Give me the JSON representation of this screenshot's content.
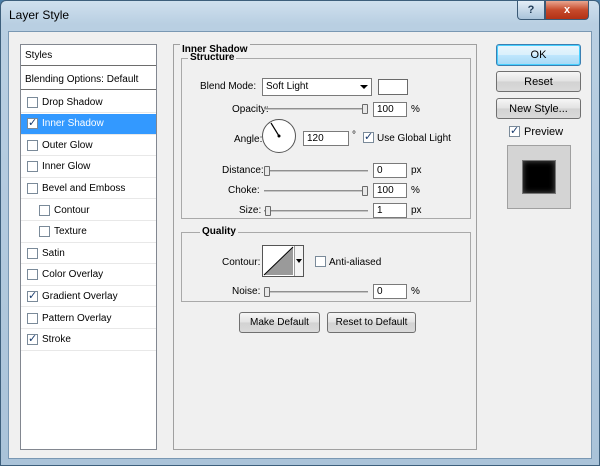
{
  "window": {
    "title": "Layer Style",
    "close_glyph": "x",
    "help_glyph": "?"
  },
  "styles_list": {
    "header": "Styles",
    "blending": "Blending Options: Default",
    "items": [
      {
        "label": "Drop Shadow",
        "checked": false,
        "indent": false,
        "selected": false
      },
      {
        "label": "Inner Shadow",
        "checked": true,
        "indent": false,
        "selected": true
      },
      {
        "label": "Outer Glow",
        "checked": false,
        "indent": false,
        "selected": false
      },
      {
        "label": "Inner Glow",
        "checked": false,
        "indent": false,
        "selected": false
      },
      {
        "label": "Bevel and Emboss",
        "checked": false,
        "indent": false,
        "selected": false
      },
      {
        "label": "Contour",
        "checked": false,
        "indent": true,
        "selected": false
      },
      {
        "label": "Texture",
        "checked": false,
        "indent": true,
        "selected": false
      },
      {
        "label": "Satin",
        "checked": false,
        "indent": false,
        "selected": false
      },
      {
        "label": "Color Overlay",
        "checked": false,
        "indent": false,
        "selected": false
      },
      {
        "label": "Gradient Overlay",
        "checked": true,
        "indent": false,
        "selected": false
      },
      {
        "label": "Pattern Overlay",
        "checked": false,
        "indent": false,
        "selected": false
      },
      {
        "label": "Stroke",
        "checked": true,
        "indent": false,
        "selected": false
      }
    ]
  },
  "panel": {
    "title": "Inner Shadow",
    "structure": {
      "title": "Structure",
      "blend_mode_label": "Blend Mode:",
      "blend_mode_value": "Soft Light",
      "swatch_color": "#ffffff",
      "opacity_label": "Opacity:",
      "opacity_value": "100",
      "angle_label": "Angle:",
      "angle_value": "120",
      "degree_sign": "°",
      "use_global_light_label": "Use Global Light",
      "use_global_light_checked": true,
      "distance_label": "Distance:",
      "distance_value": "0",
      "choke_label": "Choke:",
      "choke_value": "100",
      "size_label": "Size:",
      "size_value": "1",
      "unit_px": "px",
      "unit_pct": "%"
    },
    "quality": {
      "title": "Quality",
      "contour_label": "Contour:",
      "anti_aliased_label": "Anti-aliased",
      "anti_aliased_checked": false,
      "noise_label": "Noise:",
      "noise_value": "0",
      "unit_pct": "%"
    },
    "make_default": "Make Default",
    "reset_default": "Reset to Default"
  },
  "right": {
    "ok": "OK",
    "reset": "Reset",
    "new_style": "New Style...",
    "preview_label": "Preview",
    "preview_checked": true
  },
  "sliders": {
    "opacity": 1.0,
    "distance": 0.0,
    "choke": 1.0,
    "size": 0.01,
    "noise": 0.0
  }
}
